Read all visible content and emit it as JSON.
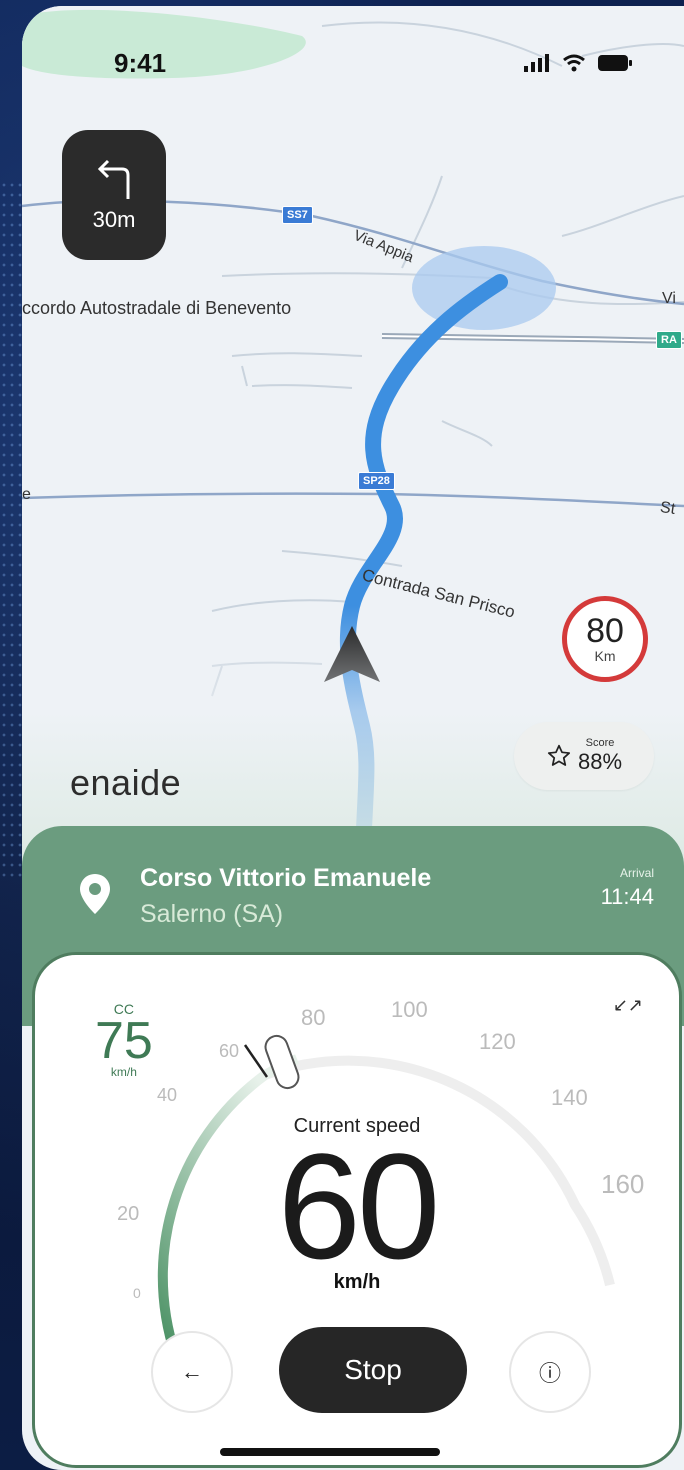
{
  "status": {
    "time": "9:41"
  },
  "navigation": {
    "turn_distance": "30m",
    "map_labels": {
      "road_1": "Via Appia",
      "road_2": "ccordo Autostradale di Benevento",
      "road_3": "Contrada San Prisco",
      "edge_left": "e",
      "edge_right_top": "Vi",
      "edge_right_mid": "St",
      "shield_1": "SS7",
      "shield_2": "SP28",
      "shield_3": "RA"
    },
    "speed_limit": {
      "value": "80",
      "unit": "Km"
    },
    "score": {
      "label": "Score",
      "value": "88%"
    },
    "brand": "enaide"
  },
  "destination": {
    "street": "Corso Vittorio Emanuele",
    "city": "Salerno (SA)",
    "arrival_label": "Arrival",
    "arrival_time": "11:44"
  },
  "speedometer": {
    "cruise_label": "CC",
    "cruise_value": "75",
    "cruise_unit": "km/h",
    "ticks": [
      "0",
      "20",
      "40",
      "60",
      "80",
      "100",
      "120",
      "140",
      "160"
    ],
    "current_label": "Current speed",
    "current_value": "60",
    "current_unit": "km/h",
    "stop_label": "Stop",
    "back_icon": "←",
    "info_icon": "ⓘ",
    "collapse_icon": "↙↗"
  },
  "colors": {
    "accent_green": "#6b9c7f",
    "route_blue": "#3d8fe0",
    "limit_red": "#d43a3a",
    "dark": "#2b2b2b"
  }
}
